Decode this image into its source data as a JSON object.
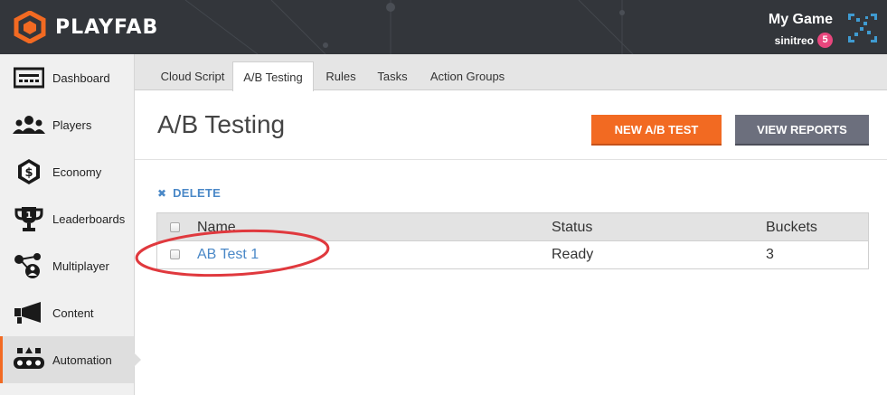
{
  "header": {
    "brand": "PLAYFAB",
    "game_name": "My Game",
    "user_name": "sinitreo",
    "notification_count": "5"
  },
  "sidebar": {
    "items": [
      {
        "label": "Dashboard",
        "icon": "dashboard-icon"
      },
      {
        "label": "Players",
        "icon": "players-icon"
      },
      {
        "label": "Economy",
        "icon": "economy-icon"
      },
      {
        "label": "Leaderboards",
        "icon": "trophy-icon"
      },
      {
        "label": "Multiplayer",
        "icon": "multiplayer-icon"
      },
      {
        "label": "Content",
        "icon": "megaphone-icon"
      },
      {
        "label": "Automation",
        "icon": "automation-icon"
      }
    ],
    "active": "Automation"
  },
  "tabs": {
    "items": [
      {
        "label": "Cloud Script"
      },
      {
        "label": "A/B Testing"
      },
      {
        "label": "Rules"
      },
      {
        "label": "Tasks"
      },
      {
        "label": "Action Groups"
      }
    ],
    "active": "A/B Testing"
  },
  "page": {
    "title": "A/B Testing",
    "new_button": "NEW A/B TEST",
    "reports_button": "VIEW REPORTS",
    "delete_label": "DELETE"
  },
  "table": {
    "columns": [
      "Name",
      "Status",
      "Buckets"
    ],
    "rows": [
      {
        "name": "AB Test 1",
        "status": "Ready",
        "buckets": "3"
      }
    ]
  },
  "colors": {
    "accent": "#f26a22",
    "link": "#4a88c7",
    "topbar": "#33363b",
    "annotation": "#e0393e"
  }
}
